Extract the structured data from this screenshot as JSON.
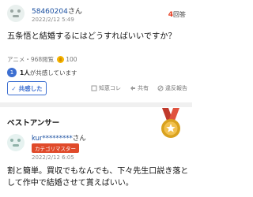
{
  "question": {
    "user_name": "58460204",
    "user_suffix": "さん",
    "date": "2022/2/12 5:49",
    "views_number": "4",
    "views_unit": "回答",
    "text": "五条悟と結婚するにはどうすればいいですか？",
    "category": "アニメ",
    "view_count": "968閲覧",
    "coin_amount": "100",
    "empathy_count": "1人",
    "empathy_text": "が共感しています",
    "empathy_icon": "1"
  },
  "actions": {
    "empathize_label": "共感した",
    "empathize_icon": "✓",
    "wisdom_label": "知恵コレ",
    "share_label": "共有",
    "report_label": "違反報告"
  },
  "best_answer": {
    "title": "ベストアンサー",
    "user_name": "kur*********",
    "user_suffix": "さん",
    "badge": "カテゴリマスター",
    "date": "2022/2/12 6:05",
    "line1": "割と簡単。買収でもなんでも、下々先生口説き落と",
    "line2": "して作中で結婚させて貰えばいい。"
  },
  "icons": {
    "check": "check-icon",
    "bookmark": "bookmark-icon",
    "share": "share-icon",
    "report": "report-icon",
    "coin": "coin-icon",
    "medal": "medal-icon"
  },
  "colors": {
    "link_blue": "#1a4fa0",
    "accent_blue": "#3d6fd1",
    "answer_count_red": "#e53a1e",
    "badge_red": "#e04a2a",
    "medal_gold": "#d9a21f"
  }
}
